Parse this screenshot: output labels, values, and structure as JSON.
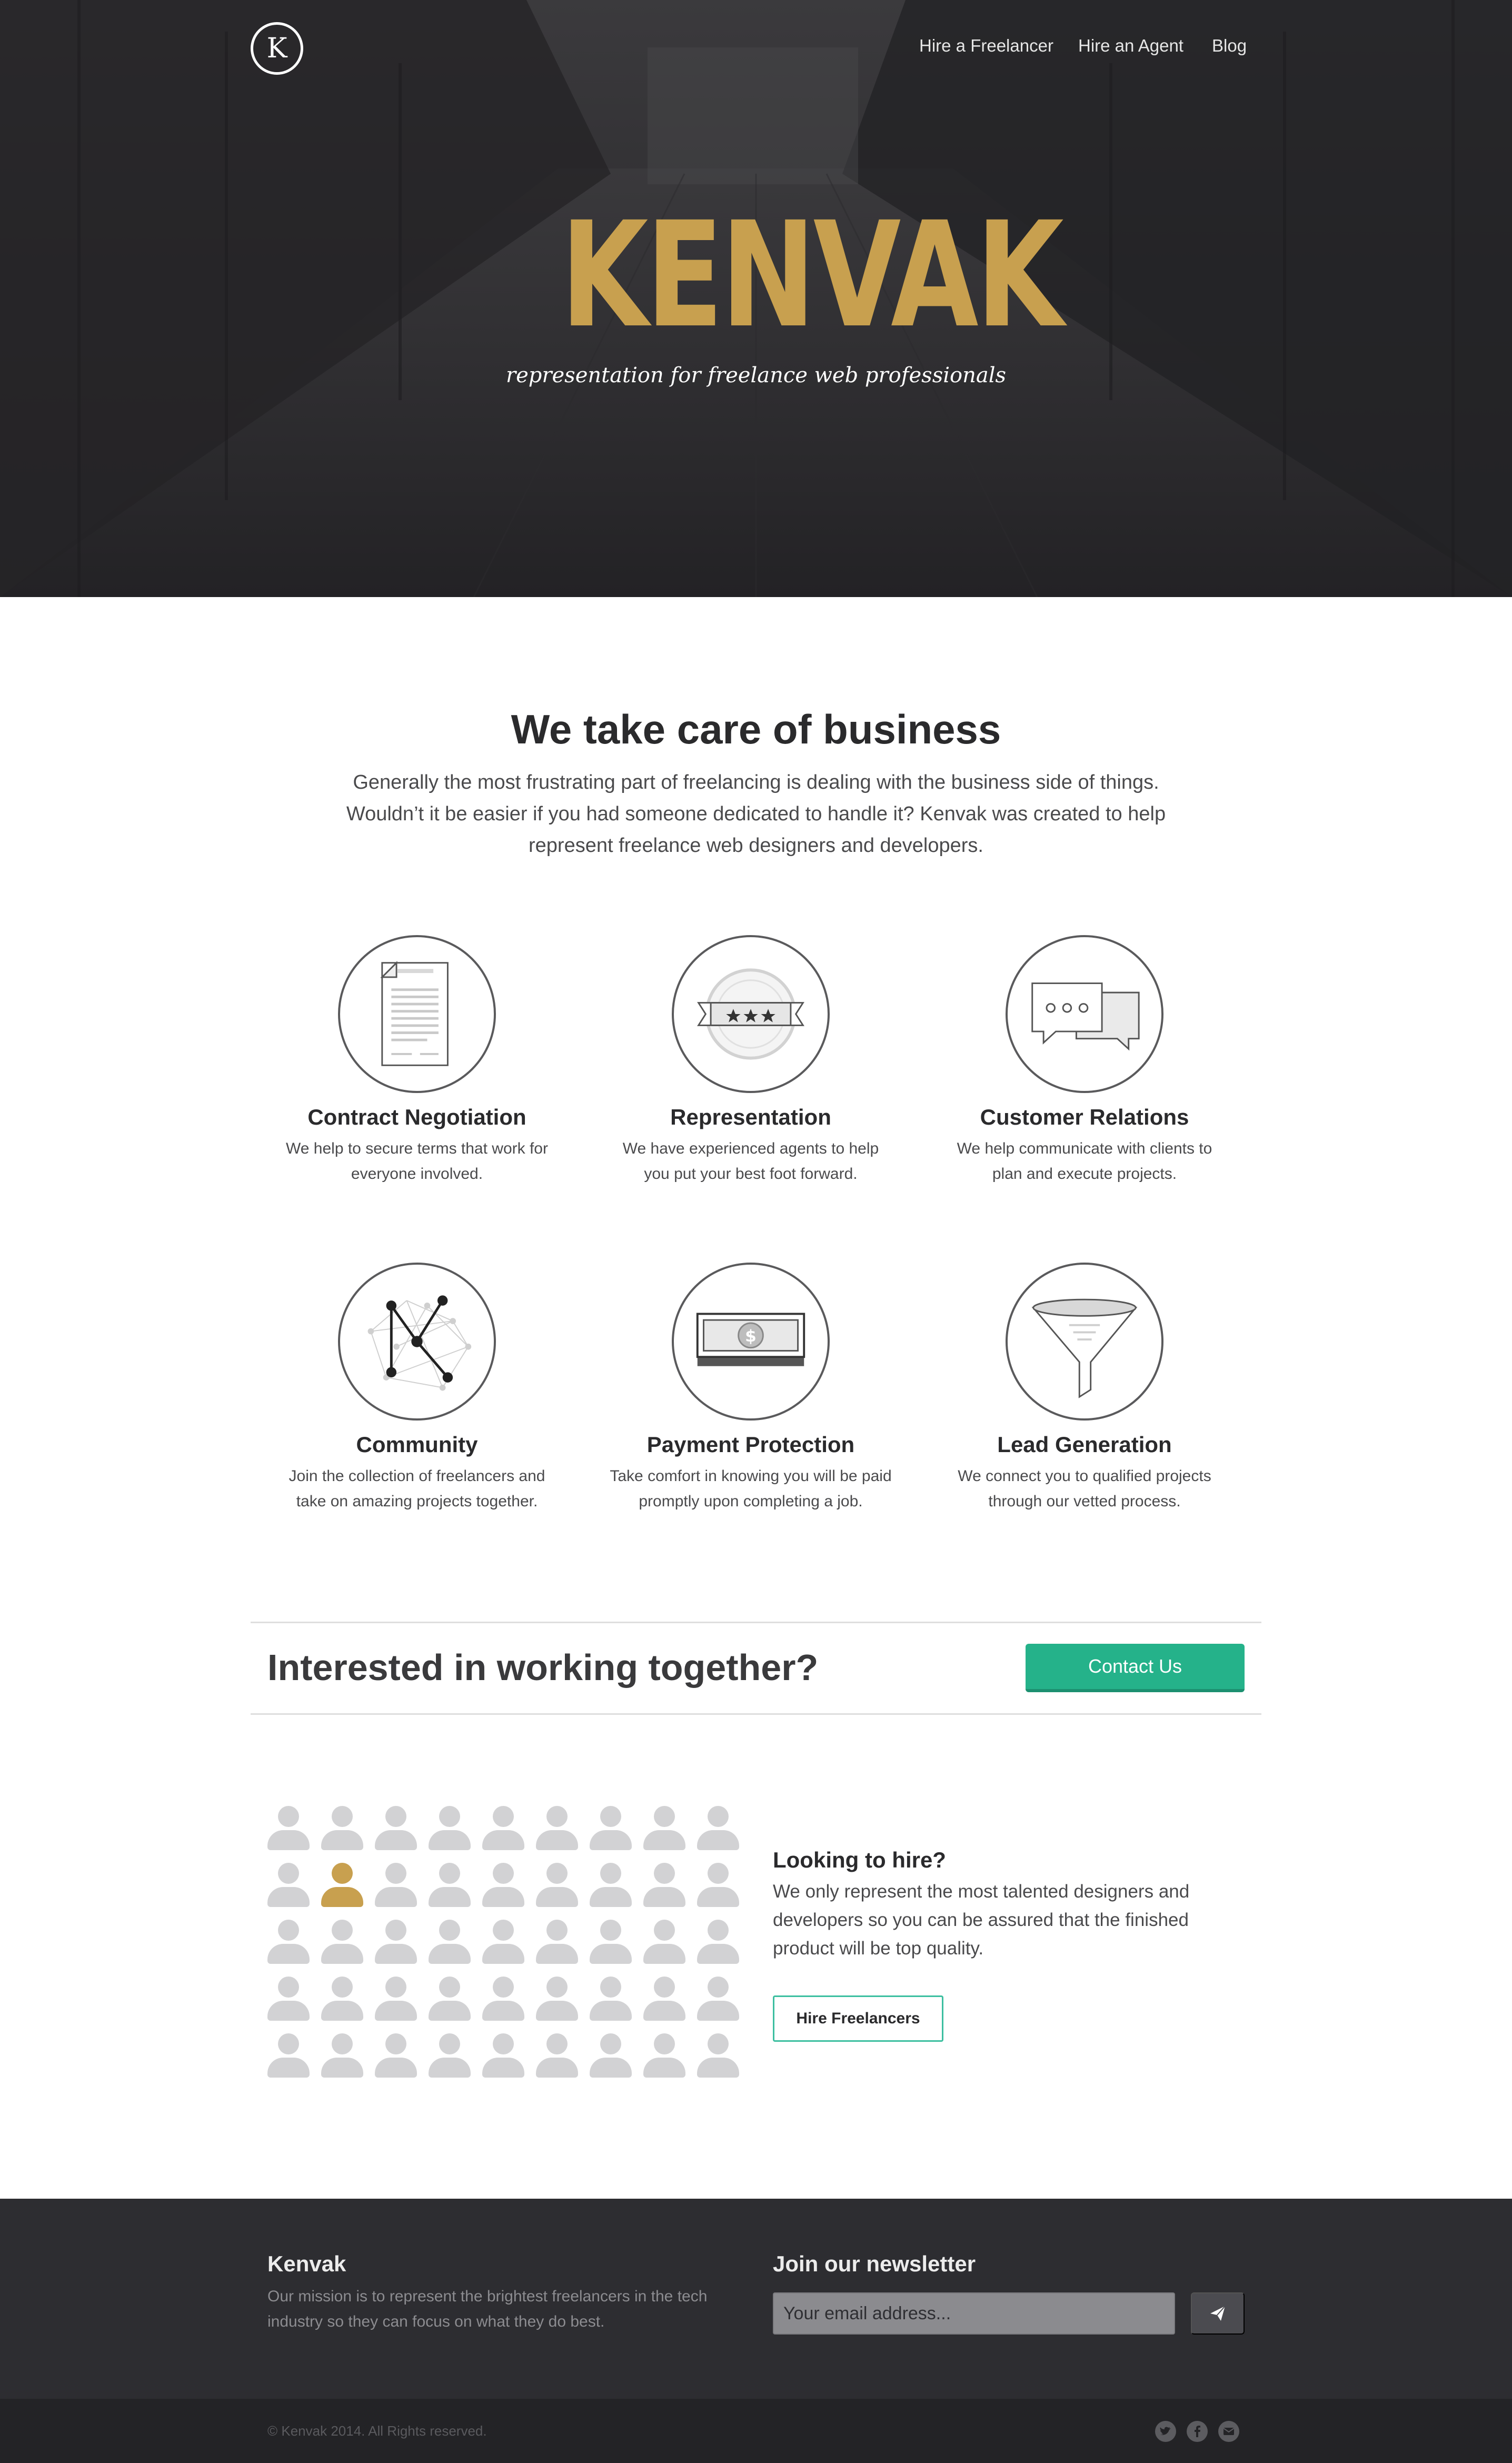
{
  "header": {
    "logo_letter": "K",
    "nav": [
      "Hire a Freelancer",
      "Hire an Agent",
      "Blog"
    ]
  },
  "hero": {
    "title": "KENVAK",
    "tagline": "representation for freelance web professionals"
  },
  "intro": {
    "title": "We take care of business",
    "text": "Generally the most frustrating part of freelancing is dealing with the business side of things. Wouldn’t it be easier if you had someone dedicated to handle it? Kenvak was created to help represent freelance web designers and developers."
  },
  "features": [
    {
      "icon": "contract-icon",
      "title": "Contract Negotiation",
      "desc": "We help to secure terms that work for everyone involved."
    },
    {
      "icon": "badge-icon",
      "title": "Representation",
      "desc": "We have experienced agents to help you put your best foot forward."
    },
    {
      "icon": "chat-bubbles-icon",
      "title": "Customer Relations",
      "desc": "We help communicate with clients to plan and execute projects."
    },
    {
      "icon": "network-icon",
      "title": "Community",
      "desc": "Join the collection of freelancers and take on amazing projects together."
    },
    {
      "icon": "money-icon",
      "title": "Payment Protection",
      "desc": "Take comfort in knowing you will be paid promptly upon completing a job."
    },
    {
      "icon": "funnel-icon",
      "title": "Lead Generation",
      "desc": "We connect you to qualified projects through our vetted process."
    }
  ],
  "cta": {
    "text": "Interested in working together?",
    "button": "Contact Us",
    "accent": "#25b28a"
  },
  "hire": {
    "grid": {
      "rows": 5,
      "cols": 9,
      "highlighted": {
        "row": 2,
        "col": 2
      }
    },
    "title": "Looking to hire?",
    "text": "We only represent the most talented designers and developers so you can be assured that the finished product will be top quality.",
    "button": "Hire Freelancers"
  },
  "footer": {
    "brand": "Kenvak",
    "mission": "Our mission is to represent the brightest freelancers in the tech industry so they can focus on what they do best.",
    "newsletter_title": "Join our newsletter",
    "email_placeholder": "Your email address...",
    "copyright": "© Kenvak 2014. All Rights reserved.",
    "social": [
      "twitter-icon",
      "facebook-icon",
      "email-icon"
    ]
  },
  "colors": {
    "brand_gold": "#c8a04f",
    "dark_bg": "#2d2d31",
    "text_dark": "#2a2a2c"
  }
}
